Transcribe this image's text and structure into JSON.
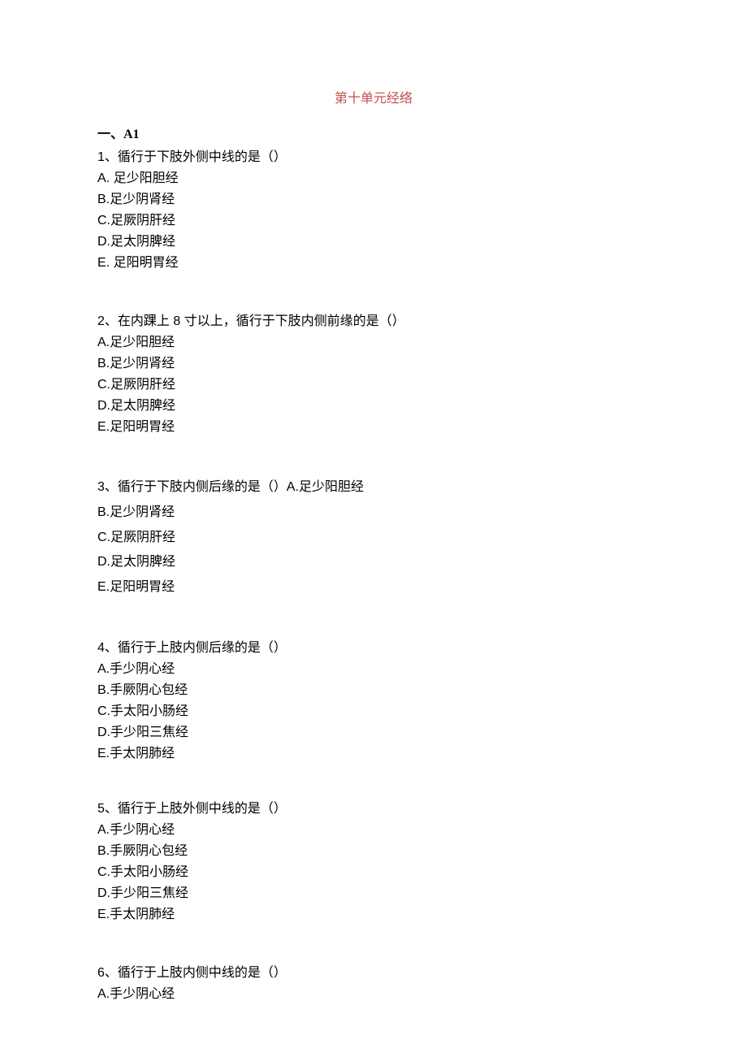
{
  "title": "第十单元经络",
  "section_label": "一、A1",
  "q1": {
    "stem": "1、循行于下肢外侧中线的是（）",
    "A": "A. 足少阳胆经",
    "B": "B.足少阴肾经",
    "C": "C.足厥阴肝经",
    "D": "D.足太阴脾经",
    "E": "E. 足阳明胃经"
  },
  "q2": {
    "stem": "2、在内踝上 8 寸以上，循行于下肢内侧前缘的是（）",
    "A": "A.足少阳胆经",
    "B": "B.足少阴肾经",
    "C": "C.足厥阴肝经",
    "D": "D.足太阴脾经",
    "E": "E.足阳明胃经"
  },
  "q3": {
    "stem": "3、循行于下肢内侧后缘的是（）",
    "A": "A.足少阳胆经",
    "B": "B.足少阴肾经",
    "C": "C.足厥阴肝经",
    "D": "D.足太阴脾经",
    "E": "E.足阳明胃经"
  },
  "q4": {
    "stem": "4、循行于上肢内侧后缘的是（）",
    "A": "A.手少阴心经",
    "B": "B.手厥阴心包经",
    "C": "C.手太阳小肠经",
    "D": "D.手少阳三焦经",
    "E": "E.手太阴肺经"
  },
  "q5": {
    "stem": "5、循行于上肢外侧中线的是（）",
    "A": "A.手少阴心经",
    "B": "B.手厥阴心包经",
    "C": "C.手太阳小肠经",
    "D": "D.手少阳三焦经",
    "E": "E.手太阴肺经"
  },
  "q6": {
    "stem": "6、循行于上肢内侧中线的是（）",
    "A": "A.手少阴心经"
  }
}
